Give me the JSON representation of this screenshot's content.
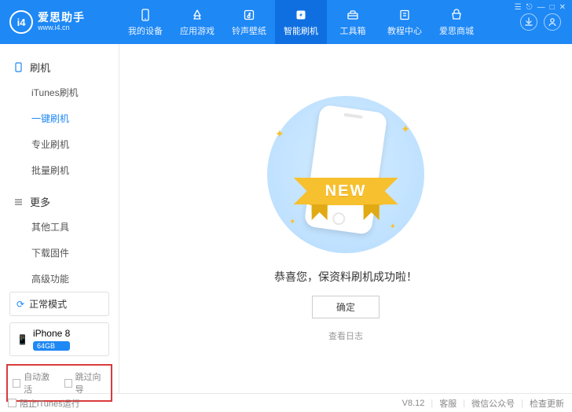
{
  "brand": {
    "logo_text": "i4",
    "title": "爱思助手",
    "url": "www.i4.cn"
  },
  "nav": {
    "items": [
      {
        "label": "我的设备",
        "icon": "phone-icon"
      },
      {
        "label": "应用游戏",
        "icon": "app-icon"
      },
      {
        "label": "铃声壁纸",
        "icon": "music-icon"
      },
      {
        "label": "智能刷机",
        "icon": "flash-icon",
        "active": true
      },
      {
        "label": "工具箱",
        "icon": "toolbox-icon"
      },
      {
        "label": "教程中心",
        "icon": "book-icon"
      },
      {
        "label": "爱思商城",
        "icon": "shop-icon"
      }
    ]
  },
  "sidebar": {
    "groups": [
      {
        "title": "刷机",
        "icon": "phone-outline-icon",
        "items": [
          {
            "label": "iTunes刷机"
          },
          {
            "label": "一键刷机",
            "active": true
          },
          {
            "label": "专业刷机"
          },
          {
            "label": "批量刷机"
          }
        ]
      },
      {
        "title": "更多",
        "icon": "more-icon",
        "items": [
          {
            "label": "其他工具"
          },
          {
            "label": "下载固件"
          },
          {
            "label": "高级功能"
          }
        ]
      }
    ],
    "status": {
      "icon": "refresh-icon",
      "label": "正常模式"
    },
    "device": {
      "icon": "device-icon",
      "name": "iPhone 8",
      "badge": "64GB"
    },
    "options": [
      {
        "label": "自动激活",
        "checked": false
      },
      {
        "label": "跳过向导",
        "checked": false
      }
    ]
  },
  "main": {
    "ribbon_text": "NEW",
    "message": "恭喜您，保资料刷机成功啦！",
    "ok_button": "确定",
    "log_link": "查看日志"
  },
  "footer": {
    "block_itunes": "阻止iTunes运行",
    "version": "V8.12",
    "links": [
      "客服",
      "微信公众号",
      "检查更新"
    ]
  },
  "win_controls": [
    "menu",
    "pin",
    "min",
    "max",
    "close"
  ]
}
